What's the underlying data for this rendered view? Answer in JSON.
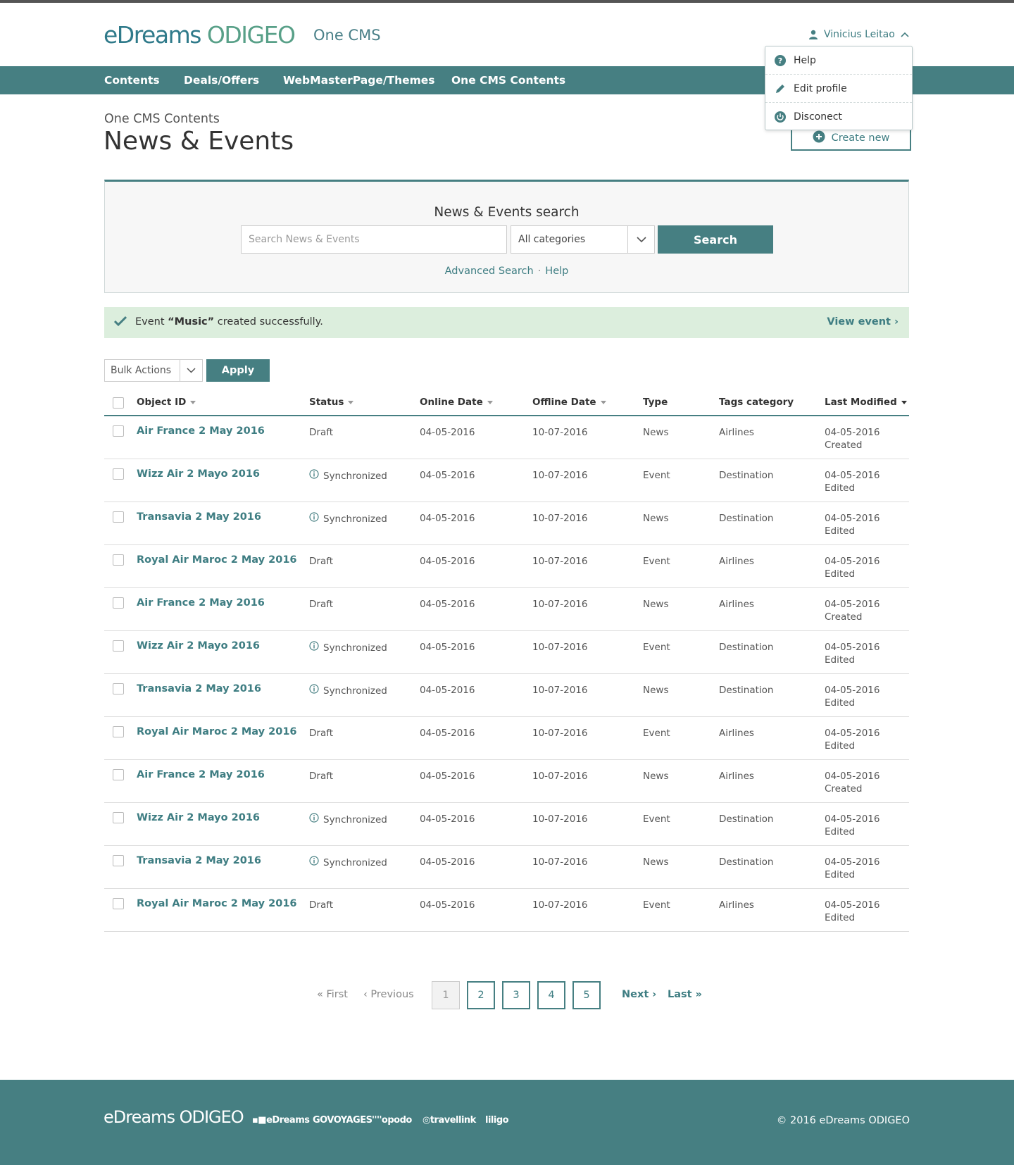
{
  "header": {
    "logo_left": "eDreams",
    "logo_right": "ODIGEO",
    "product": "One CMS",
    "user_name": "Vinicius Leitao"
  },
  "user_menu": {
    "items": [
      "Help",
      "Edit profile",
      "Disconect"
    ]
  },
  "nav": {
    "items": [
      "Contents",
      "Deals/Offers",
      "WebMasterPage/Themes",
      "One CMS Contents"
    ]
  },
  "page": {
    "breadcrumb": "One CMS Contents",
    "title": "News & Events",
    "create_label": "Create new"
  },
  "search": {
    "title": "News & Events search",
    "placeholder": "Search News & Events",
    "category": "All categories",
    "button": "Search",
    "advanced_label": "Advanced Search",
    "separator": "·",
    "help_label": "Help"
  },
  "alert": {
    "prefix": "Event ",
    "name": "“Music”",
    "suffix": " created successfully.",
    "view_label": "View event ›"
  },
  "bulk": {
    "select_value": "Bulk Actions",
    "apply_label": "Apply"
  },
  "table": {
    "headers": [
      "Object ID",
      "Status",
      "Online Date",
      "Offline Date",
      "Type",
      "Tags category",
      "Last Modified"
    ],
    "rows": [
      {
        "id": "Air France 2 May 2016",
        "status": "Draft",
        "sync": false,
        "online": "04-05-2016",
        "offline": "10-07-2016",
        "type": "News",
        "tags": "Airlines",
        "modified_date": "04-05-2016",
        "modified_action": "Created"
      },
      {
        "id": "Wizz Air 2 Mayo 2016",
        "status": "Synchronized",
        "sync": true,
        "online": "04-05-2016",
        "offline": "10-07-2016",
        "type": "Event",
        "tags": "Destination",
        "modified_date": "04-05-2016",
        "modified_action": "Edited"
      },
      {
        "id": "Transavia 2 May 2016",
        "status": "Synchronized",
        "sync": true,
        "online": "04-05-2016",
        "offline": "10-07-2016",
        "type": "News",
        "tags": "Destination",
        "modified_date": "04-05-2016",
        "modified_action": "Edited"
      },
      {
        "id": "Royal Air Maroc 2 May 2016",
        "status": "Draft",
        "sync": false,
        "online": "04-05-2016",
        "offline": "10-07-2016",
        "type": "Event",
        "tags": "Airlines",
        "modified_date": "04-05-2016",
        "modified_action": "Edited"
      },
      {
        "id": "Air France 2 May 2016",
        "status": "Draft",
        "sync": false,
        "online": "04-05-2016",
        "offline": "10-07-2016",
        "type": "News",
        "tags": "Airlines",
        "modified_date": "04-05-2016",
        "modified_action": "Created"
      },
      {
        "id": "Wizz Air 2 Mayo 2016",
        "status": "Synchronized",
        "sync": true,
        "online": "04-05-2016",
        "offline": "10-07-2016",
        "type": "Event",
        "tags": "Destination",
        "modified_date": "04-05-2016",
        "modified_action": "Edited"
      },
      {
        "id": "Transavia 2 May 2016",
        "status": "Synchronized",
        "sync": true,
        "online": "04-05-2016",
        "offline": "10-07-2016",
        "type": "News",
        "tags": "Destination",
        "modified_date": "04-05-2016",
        "modified_action": "Edited"
      },
      {
        "id": "Royal Air Maroc 2 May 2016",
        "status": "Draft",
        "sync": false,
        "online": "04-05-2016",
        "offline": "10-07-2016",
        "type": "Event",
        "tags": "Airlines",
        "modified_date": "04-05-2016",
        "modified_action": "Edited"
      },
      {
        "id": "Air France 2 May 2016",
        "status": "Draft",
        "sync": false,
        "online": "04-05-2016",
        "offline": "10-07-2016",
        "type": "News",
        "tags": "Airlines",
        "modified_date": "04-05-2016",
        "modified_action": "Created"
      },
      {
        "id": "Wizz Air 2 Mayo 2016",
        "status": "Synchronized",
        "sync": true,
        "online": "04-05-2016",
        "offline": "10-07-2016",
        "type": "Event",
        "tags": "Destination",
        "modified_date": "04-05-2016",
        "modified_action": "Edited"
      },
      {
        "id": "Transavia 2 May 2016",
        "status": "Synchronized",
        "sync": true,
        "online": "04-05-2016",
        "offline": "10-07-2016",
        "type": "News",
        "tags": "Destination",
        "modified_date": "04-05-2016",
        "modified_action": "Edited"
      },
      {
        "id": "Royal Air Maroc 2 May 2016",
        "status": "Draft",
        "sync": false,
        "online": "04-05-2016",
        "offline": "10-07-2016",
        "type": "Event",
        "tags": "Airlines",
        "modified_date": "04-05-2016",
        "modified_action": "Edited"
      }
    ]
  },
  "pagination": {
    "first": "« First",
    "previous": "‹ Previous",
    "pages": [
      "1",
      "2",
      "3",
      "4",
      "5"
    ],
    "current": "1",
    "next": "Next ›",
    "last": "Last »"
  },
  "footer": {
    "logo": "eDreams ODIGEO",
    "brands": [
      "eDreams",
      "GOVOYAGES",
      "opodo",
      "travellink",
      "liligo"
    ],
    "copyright": "© 2016 eDreams ODIGEO"
  },
  "colors": {
    "brand": "#467f82",
    "link": "#3e7d82",
    "alert_bg": "#dceedd"
  },
  "icons": [
    "user-icon",
    "chevron-up-icon",
    "help-icon",
    "pencil-icon",
    "power-icon",
    "plus-circle-icon",
    "chevron-down-icon",
    "check-icon",
    "info-icon"
  ]
}
